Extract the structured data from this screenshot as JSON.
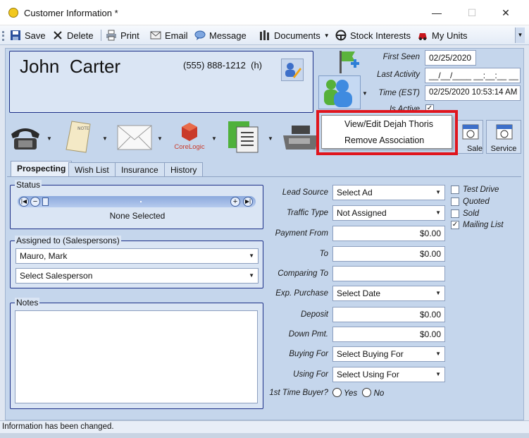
{
  "window": {
    "title": "Customer Information *",
    "minimize": "—",
    "maximize": "☐",
    "close": "✕"
  },
  "toolbar": {
    "save": "Save",
    "delete": "Delete",
    "print": "Print",
    "email": "Email",
    "message": "Message",
    "documents": "Documents",
    "stock_interests": "Stock Interests",
    "my_units": "My Units"
  },
  "customer": {
    "first_name": "John",
    "last_name": "Carter",
    "phone": "(555) 888-1212  (h)"
  },
  "info": {
    "first_seen_label": "First Seen",
    "first_seen": "02/25/2020",
    "last_activity_label": "Last Activity",
    "last_activity": "__/__/____ __:__:__ __",
    "time_label": "Time (EST)",
    "time": "02/25/2020 10:53:14 AM",
    "is_active_label": "Is Active",
    "is_active_mark": "✓"
  },
  "actions": {
    "corelogic": "CoreLogic",
    "sale": "Sale",
    "service": "Service"
  },
  "context_menu": {
    "items": [
      "View/Edit Dejah Thoris",
      "Remove Association"
    ]
  },
  "tabs": [
    "Prospecting",
    "Wish List",
    "Insurance",
    "History"
  ],
  "status_group": {
    "legend": "Status",
    "value": "None Selected"
  },
  "assigned": {
    "legend": "Assigned to (Salespersons)",
    "first": "Mauro, Mark",
    "second": "Select Salesperson"
  },
  "notes": {
    "legend": "Notes"
  },
  "form": {
    "lead_source_label": "Lead Source",
    "lead_source": "Select Ad",
    "traffic_type_label": "Traffic Type",
    "traffic_type": "Not Assigned",
    "payment_from_label": "Payment From",
    "payment_from": "$0.00",
    "to_label": "To",
    "to": "$0.00",
    "comparing_to_label": "Comparing To",
    "comparing_to": "",
    "exp_purchase_label": "Exp. Purchase",
    "exp_purchase": "Select Date",
    "deposit_label": "Deposit",
    "deposit": "$0.00",
    "down_pmt_label": "Down Pmt.",
    "down_pmt": "$0.00",
    "buying_for_label": "Buying For",
    "buying_for": "Select Buying For",
    "using_for_label": "Using For",
    "using_for": "Select Using For",
    "first_time_label": "1st Time Buyer?",
    "yes": "Yes",
    "no": "No"
  },
  "checks": {
    "test_drive": "Test Drive",
    "quoted": "Quoted",
    "sold": "Sold",
    "mailing_list": "Mailing List",
    "mailing_mark": "✓"
  },
  "statusbar": {
    "text": "Information has been changed."
  },
  "colors": {
    "highlight": "#e0151d",
    "border": "#1c2f87",
    "panel": "#c5d6ec"
  }
}
